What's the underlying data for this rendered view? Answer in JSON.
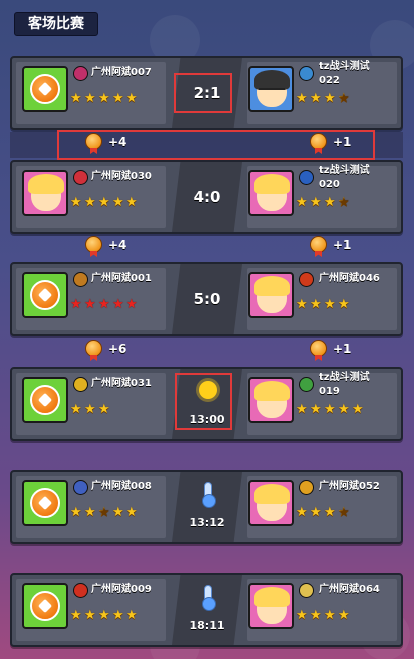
{
  "title": "客场比赛",
  "matches": [
    {
      "home": {
        "name": "广州阿斌007",
        "avatar": "soccer-ball",
        "stars": [
          1,
          1,
          1,
          1,
          1
        ],
        "badge_color": "#c0306a"
      },
      "away": {
        "name": "tz战斗测试022",
        "avatar": "glasses-boy",
        "stars": [
          1,
          1,
          1,
          0.5
        ],
        "badge_color": "#3a8ad0"
      },
      "center": {
        "type": "score",
        "text": "2:1"
      },
      "reward_home": "+4",
      "reward_away": "+1"
    },
    {
      "home": {
        "name": "广州阿斌030",
        "avatar": "blonde-girl",
        "stars": [
          1,
          1,
          1,
          1,
          1
        ],
        "badge_color": "#d0303a"
      },
      "away": {
        "name": "tz战斗测试020",
        "avatar": "blonde-girl",
        "stars": [
          1,
          1,
          1,
          0.5
        ],
        "badge_color": "#2a60c0"
      },
      "center": {
        "type": "score",
        "text": "4:0"
      },
      "reward_home": "+4",
      "reward_away": "+1"
    },
    {
      "home": {
        "name": "广州阿斌001",
        "avatar": "soccer-ball",
        "stars": [
          1,
          1,
          1,
          1,
          1
        ],
        "star_color": "red",
        "badge_color": "#c07a20"
      },
      "away": {
        "name": "广州阿斌046",
        "avatar": "blonde-girl",
        "stars": [
          1,
          1,
          1,
          1
        ],
        "badge_color": "#d03a1a"
      },
      "center": {
        "type": "score",
        "text": "5:0"
      },
      "reward_home": "+6",
      "reward_away": "+1"
    },
    {
      "home": {
        "name": "广州阿斌031",
        "avatar": "soccer-ball",
        "stars": [
          1,
          1,
          1
        ],
        "badge_color": "#e0b020"
      },
      "away": {
        "name": "tz战斗测试019",
        "avatar": "blonde-girl",
        "stars": [
          1,
          1,
          1,
          1,
          1
        ],
        "badge_color": "#40a040"
      },
      "center": {
        "type": "weather",
        "icon": "sun-icon",
        "time": "13:00"
      }
    },
    {
      "home": {
        "name": "广州阿斌008",
        "avatar": "soccer-ball",
        "stars": [
          1,
          1,
          0.5,
          1,
          1
        ],
        "badge_color": "#4060c0"
      },
      "away": {
        "name": "广州阿斌052",
        "avatar": "blonde-girl",
        "stars": [
          1,
          1,
          1,
          0.5
        ],
        "badge_color": "#e0a020"
      },
      "center": {
        "type": "weather",
        "icon": "thermometer-icon",
        "time": "13:12"
      }
    },
    {
      "home": {
        "name": "广州阿斌009",
        "avatar": "soccer-ball",
        "stars": [
          1,
          1,
          1,
          1,
          1
        ],
        "badge_color": "#d03020"
      },
      "away": {
        "name": "广州阿斌064",
        "avatar": "blonde-girl",
        "stars": [
          1,
          1,
          1,
          1
        ],
        "badge_color": "#e0c050"
      },
      "center": {
        "type": "weather",
        "icon": "thermometer-icon",
        "time": "18:11"
      }
    }
  ]
}
